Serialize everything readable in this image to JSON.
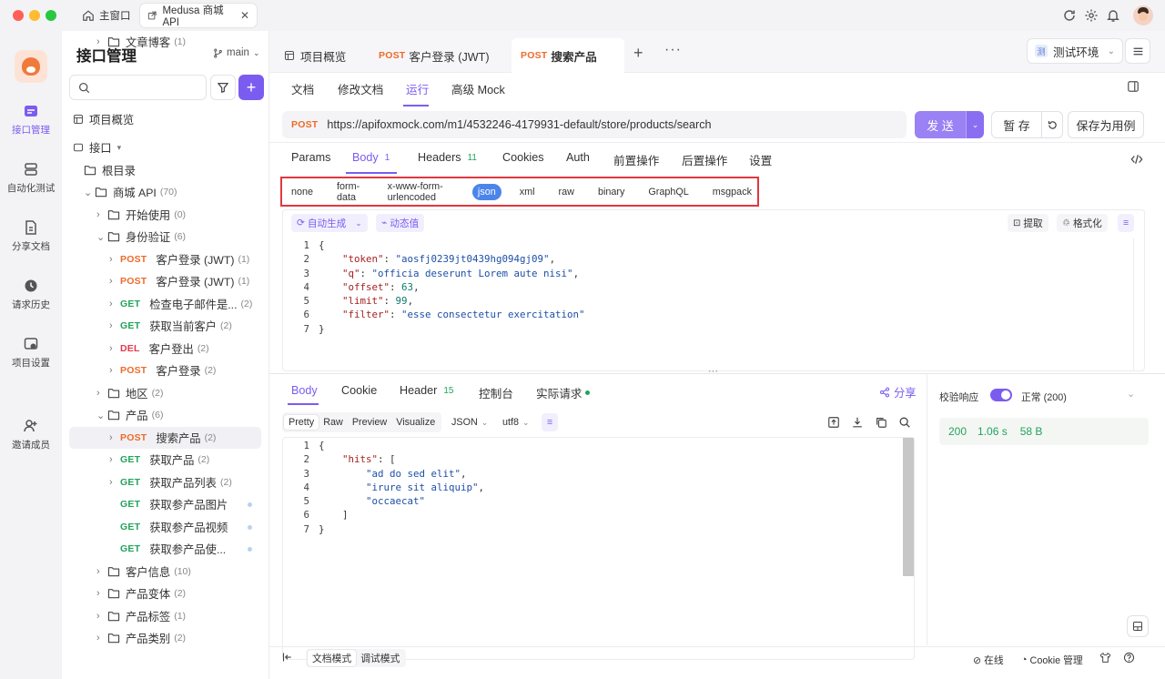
{
  "window": {
    "home_tab": "主窗口",
    "project_tab": "Medusa 商城 API"
  },
  "colors": {
    "accent": "#7b5cf0",
    "post": "#ee6a2a",
    "get": "#21a45a",
    "del": "#e4384a",
    "highlight_border": "#e0383e",
    "success": "#21a45a"
  },
  "nav": {
    "items": [
      {
        "label": "接口管理",
        "icon": "api-icon"
      },
      {
        "label": "自动化测试",
        "icon": "automation-icon"
      },
      {
        "label": "分享文档",
        "icon": "share-doc-icon"
      },
      {
        "label": "请求历史",
        "icon": "history-icon"
      },
      {
        "label": "项目设置",
        "icon": "settings-icon"
      },
      {
        "label": "邀请成员",
        "icon": "invite-icon"
      }
    ]
  },
  "sidebar": {
    "title": "接口管理",
    "branch": "main",
    "overview": "项目概览",
    "tree": [
      {
        "label": "接口",
        "type": "root"
      },
      {
        "label": "根目录",
        "type": "folder",
        "depth": 0
      },
      {
        "label": "商城 API",
        "count": "(70)",
        "type": "folder",
        "depth": 0,
        "open": true
      },
      {
        "label": "开始使用",
        "count": "(0)",
        "type": "folder",
        "depth": 1
      },
      {
        "label": "身份验证",
        "count": "(6)",
        "type": "folder",
        "depth": 1,
        "open": true
      },
      {
        "method": "POST",
        "label": "客户登录 (JWT)",
        "count": "(1)",
        "depth": 2
      },
      {
        "method": "POST",
        "label": "客户登录 (JWT)",
        "count": "(1)",
        "depth": 2
      },
      {
        "method": "GET",
        "label": "检查电子邮件是...",
        "count": "(2)",
        "depth": 2
      },
      {
        "method": "GET",
        "label": "获取当前客户",
        "count": "(2)",
        "depth": 2
      },
      {
        "method": "DEL",
        "label": "客户登出",
        "count": "(2)",
        "depth": 2
      },
      {
        "method": "POST",
        "label": "客户登录",
        "count": "(2)",
        "depth": 2
      },
      {
        "label": "地区",
        "count": "(2)",
        "type": "folder",
        "depth": 1
      },
      {
        "label": "产品",
        "count": "(6)",
        "type": "folder",
        "depth": 1,
        "open": true
      },
      {
        "method": "POST",
        "label": "搜索产品",
        "count": "(2)",
        "depth": 2,
        "selected": true
      },
      {
        "method": "GET",
        "label": "获取产品",
        "count": "(2)",
        "depth": 2
      },
      {
        "method": "GET",
        "label": "获取产品列表",
        "count": "(2)",
        "depth": 2
      },
      {
        "method": "GET",
        "label": "获取参产品图片",
        "count": "",
        "depth": 2
      },
      {
        "method": "GET",
        "label": "获取参产品视频",
        "count": "",
        "depth": 2
      },
      {
        "method": "GET",
        "label": "获取参产品使...",
        "count": "",
        "depth": 2
      },
      {
        "label": "客户信息",
        "count": "(10)",
        "type": "folder",
        "depth": 1
      },
      {
        "label": "产品变体",
        "count": "(2)",
        "type": "folder",
        "depth": 1
      },
      {
        "label": "产品标签",
        "count": "(1)",
        "type": "folder",
        "depth": 1
      },
      {
        "label": "产品类别",
        "count": "(2)",
        "type": "folder",
        "depth": 1
      },
      {
        "label": "文章博客",
        "count": "(1)",
        "type": "folder",
        "depth": 1
      }
    ]
  },
  "tabs": {
    "overview": "项目概览",
    "tab1_method": "POST",
    "tab1_label": "客户登录 (JWT)",
    "tab2_method": "POST",
    "tab2_label": "搜索产品",
    "env": "测试环境",
    "env_badge": "测"
  },
  "subtabs": [
    "文档",
    "修改文档",
    "运行",
    "高级 Mock"
  ],
  "request": {
    "method": "POST",
    "url": "https://apifoxmock.com/m1/4532246-4179931-default/store/products/search",
    "send": "发 送",
    "save": "暂 存",
    "save_case": "保存为用例"
  },
  "param_tabs": {
    "params": "Params",
    "body": "Body",
    "body_count": "1",
    "headers": "Headers",
    "headers_count": "11",
    "cookies": "Cookies",
    "auth": "Auth",
    "pre": "前置操作",
    "post": "后置操作",
    "settings": "设置"
  },
  "body_types": [
    "none",
    "form-data",
    "x-www-form-urlencoded",
    "json",
    "xml",
    "raw",
    "binary",
    "GraphQL",
    "msgpack"
  ],
  "body_type_selected": "json",
  "editor_tools": {
    "auto_gen": "自动生成",
    "dynamic": "动态值",
    "extract": "提取",
    "format": "格式化"
  },
  "request_body": [
    {
      "n": "1",
      "code": "{"
    },
    {
      "n": "2",
      "key": "\"token\"",
      "val": "\"aosfj0239jt0439hg094gj09\"",
      "type": "s"
    },
    {
      "n": "3",
      "key": "\"q\"",
      "val": "\"officia deserunt Lorem aute nisi\"",
      "type": "s"
    },
    {
      "n": "4",
      "key": "\"offset\"",
      "val": "63",
      "type": "n"
    },
    {
      "n": "5",
      "key": "\"limit\"",
      "val": "99",
      "type": "n"
    },
    {
      "n": "6",
      "key": "\"filter\"",
      "val": "\"esse consectetur exercitation\"",
      "type": "s",
      "last": true
    },
    {
      "n": "7",
      "code": "}"
    }
  ],
  "response": {
    "tabs": {
      "body": "Body",
      "cookie": "Cookie",
      "header": "Header",
      "header_count": "15",
      "console": "控制台",
      "actual": "实际请求"
    },
    "share": "分享",
    "views": [
      "Pretty",
      "Raw",
      "Preview",
      "Visualize"
    ],
    "format": "JSON",
    "encoding": "utf8",
    "lines": [
      {
        "n": "1",
        "code": "{"
      },
      {
        "n": "2",
        "key": "\"hits\"",
        "tail": ": ["
      },
      {
        "n": "3",
        "str": "\"ad do sed elit\"",
        "tail": ","
      },
      {
        "n": "4",
        "str": "\"irure sit aliquip\"",
        "tail": ","
      },
      {
        "n": "5",
        "str": "\"occaecat\"",
        "tail": ""
      },
      {
        "n": "6",
        "code": "]"
      },
      {
        "n": "7",
        "code": "}"
      }
    ]
  },
  "validation": {
    "label": "校验响应",
    "status": "正常 (200)",
    "code": "200",
    "time": "1.06 s",
    "size": "58 B"
  },
  "footer": {
    "doc_mode": "文档模式",
    "debug_mode": "调试模式",
    "online": "在线",
    "cookie": "Cookie 管理"
  }
}
